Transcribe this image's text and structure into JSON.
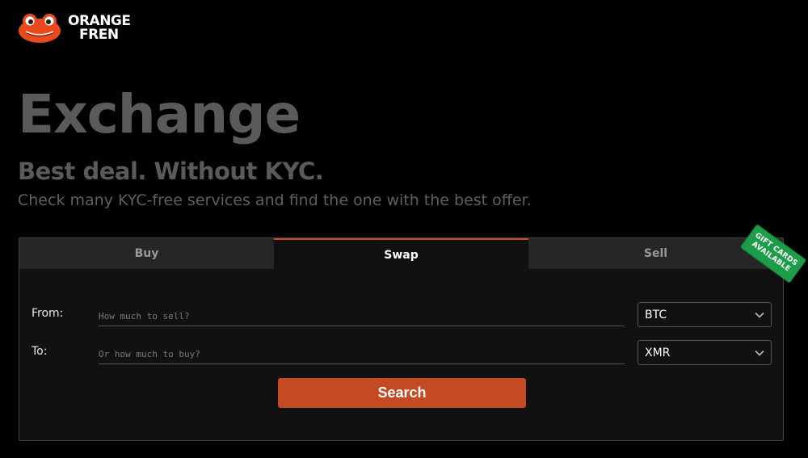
{
  "logo": {
    "line1": "ORANGE",
    "line2": "FREN",
    "icon": "frog-face-icon",
    "color": "#e8491d"
  },
  "hero": {
    "title": "Exchange",
    "subtitle": "Best deal. Without KYC.",
    "description": "Check many KYC-free services and find the one with the best offer."
  },
  "tabs": [
    {
      "label": "Buy",
      "active": false
    },
    {
      "label": "Swap",
      "active": true
    },
    {
      "label": "Sell",
      "active": false
    }
  ],
  "form": {
    "from": {
      "label": "From:",
      "placeholder": "How much to sell?",
      "value": "",
      "currency": "BTC"
    },
    "to": {
      "label": "To:",
      "placeholder": "Or how much to buy?",
      "value": "",
      "currency": "XMR"
    },
    "search_label": "Search"
  },
  "badge": {
    "line1": "GIFT CARDS",
    "line2": "AVAILABLE",
    "color": "#1d9c4a"
  },
  "colors": {
    "accent": "#c34a22",
    "background": "#000000",
    "card": "#111111"
  }
}
